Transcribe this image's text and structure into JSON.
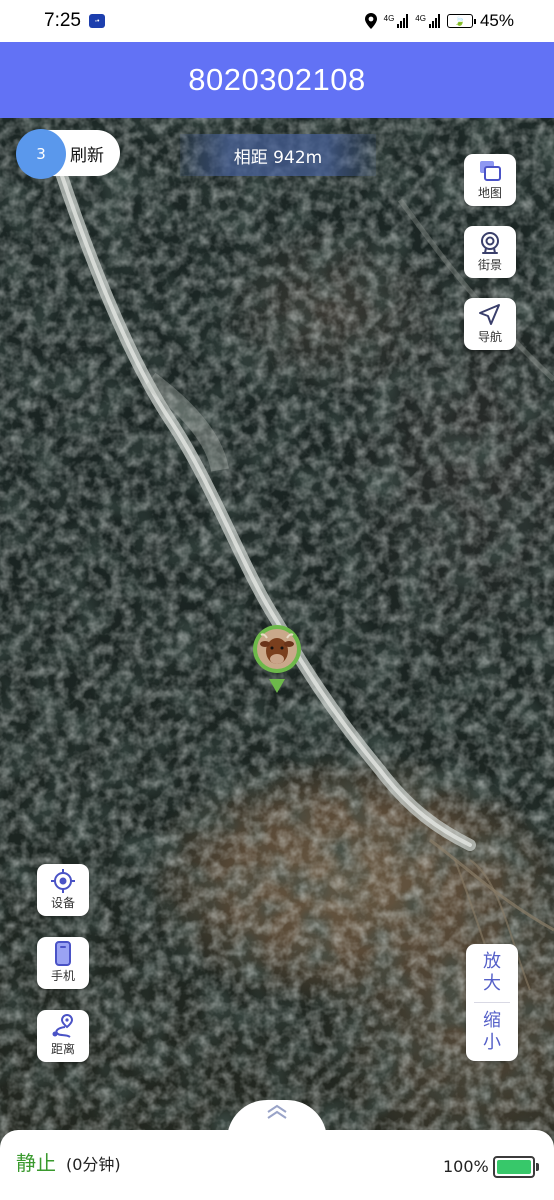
{
  "status_bar": {
    "time": "7:25",
    "battery_percent": "45%",
    "icons": [
      "app-notification-icon",
      "location-icon",
      "signal-4g-icon",
      "signal-4g-icon",
      "battery-saver-icon"
    ]
  },
  "header": {
    "title": "8020302108"
  },
  "refresh": {
    "count": "3",
    "label": "刷新"
  },
  "distance": {
    "label": "相距 942m"
  },
  "right_buttons": [
    {
      "label": "地图",
      "icon": "map-layers-icon"
    },
    {
      "label": "街景",
      "icon": "street-view-icon"
    },
    {
      "label": "导航",
      "icon": "navigation-icon"
    }
  ],
  "left_buttons": [
    {
      "label": "设备",
      "icon": "device-locate-icon"
    },
    {
      "label": "手机",
      "icon": "phone-icon"
    },
    {
      "label": "距离",
      "icon": "route-distance-icon"
    }
  ],
  "zoom": {
    "in_label_1": "放",
    "in_label_2": "大",
    "out_label_1": "缩",
    "out_label_2": "小"
  },
  "marker": {
    "icon": "cow-avatar-icon"
  },
  "bottom_panel": {
    "status": "静止",
    "duration": "(0分钟)",
    "device_battery": "100%",
    "device_battery_level": 1.0,
    "expand_icon": "chevron-up-double-icon"
  },
  "colors": {
    "header_bg": "#6272f5",
    "refresh_badge": "#5a98ec",
    "status_green": "#3a9a2e",
    "battery_green": "#37c86a",
    "button_blue": "#5560c8"
  }
}
